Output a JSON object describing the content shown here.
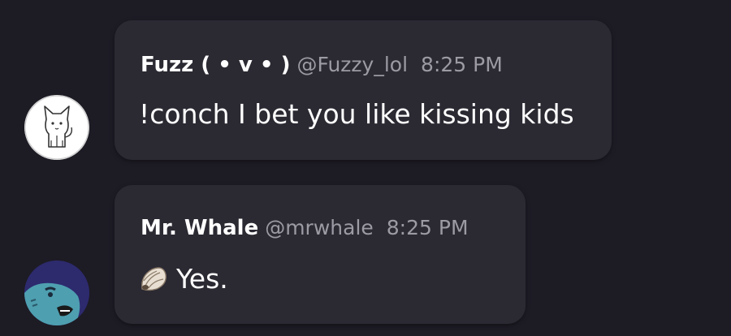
{
  "messages": [
    {
      "name": "Fuzz ( • v • )",
      "handle": "@Fuzzy_lol",
      "time": "8:25 PM",
      "text": "!conch I bet you like kissing kids",
      "avatar_icon": "cat-drawing-avatar"
    },
    {
      "name": "Mr. Whale",
      "handle": "@mrwhale",
      "time": "8:25 PM",
      "text": "Yes.",
      "emoji": "shell-emoji",
      "avatar_icon": "whale-avatar"
    }
  ],
  "colors": {
    "background": "#1d1b24",
    "bubble": "#2b2932",
    "text": "#ffffff",
    "muted": "#9c9aa3"
  }
}
